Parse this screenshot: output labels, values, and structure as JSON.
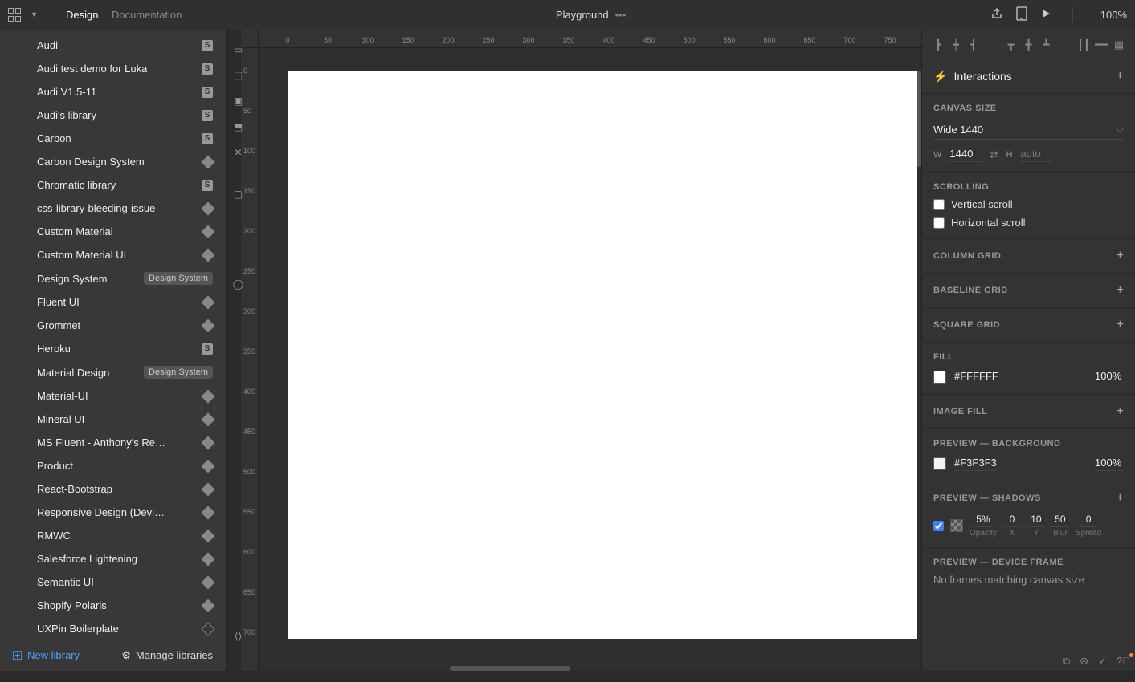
{
  "header": {
    "tabs": {
      "design": "Design",
      "documentation": "Documentation"
    },
    "title": "Playground",
    "zoom": "100%"
  },
  "libraries": {
    "items": [
      {
        "name": "Audi",
        "icon": "s"
      },
      {
        "name": "Audi test demo for Luka",
        "icon": "s"
      },
      {
        "name": "Audi V1.5-11",
        "icon": "s"
      },
      {
        "name": "Audi's library",
        "icon": "s"
      },
      {
        "name": "Carbon",
        "icon": "s"
      },
      {
        "name": "Carbon Design System",
        "icon": "d"
      },
      {
        "name": "Chromatic library",
        "icon": "s"
      },
      {
        "name": "css-library-bleeding-issue",
        "icon": "d"
      },
      {
        "name": "Custom Material",
        "icon": "d"
      },
      {
        "name": "Custom Material UI",
        "icon": "d"
      },
      {
        "name": "Design System",
        "badge": "Design System"
      },
      {
        "name": "Fluent UI",
        "icon": "d"
      },
      {
        "name": "Grommet",
        "icon": "d"
      },
      {
        "name": "Heroku",
        "icon": "s"
      },
      {
        "name": "Material Design",
        "badge": "Design System"
      },
      {
        "name": "Material-UI",
        "icon": "d"
      },
      {
        "name": "Mineral UI",
        "icon": "d"
      },
      {
        "name": "MS Fluent - Anthony's Repo",
        "icon": "d"
      },
      {
        "name": "Product",
        "icon": "d"
      },
      {
        "name": "React-Bootstrap",
        "icon": "d"
      },
      {
        "name": "Responsive Design (DeviceVie...",
        "icon": "d"
      },
      {
        "name": "RMWC",
        "icon": "d"
      },
      {
        "name": "Salesforce Lightening",
        "icon": "d"
      },
      {
        "name": "Semantic UI",
        "icon": "d"
      },
      {
        "name": "Shopify Polaris",
        "icon": "d"
      },
      {
        "name": "UXPin Boilerplate",
        "icon": "du"
      }
    ],
    "new_library": "New library",
    "manage": "Manage libraries"
  },
  "ruler_h": [
    "0",
    "50",
    "100",
    "150",
    "200",
    "250",
    "300",
    "350",
    "400",
    "450",
    "500",
    "550",
    "600",
    "650",
    "700",
    "750"
  ],
  "ruler_v": [
    "0",
    "50",
    "100",
    "150",
    "200",
    "250",
    "300",
    "350",
    "400",
    "450",
    "500",
    "550",
    "600",
    "650",
    "700"
  ],
  "right": {
    "interactions": "Interactions",
    "canvas_size": {
      "label": "CANVAS SIZE",
      "preset": "Wide 1440",
      "w_label": "W",
      "w_value": "1440",
      "h_label": "H",
      "h_placeholder": "auto"
    },
    "scrolling": {
      "label": "SCROLLING",
      "vertical": "Vertical scroll",
      "horizontal": "Horizontal scroll"
    },
    "column_grid": "COLUMN GRID",
    "baseline_grid": "BASELINE GRID",
    "square_grid": "SQUARE GRID",
    "fill": {
      "label": "FILL",
      "hex": "#FFFFFF",
      "opacity": "100%"
    },
    "image_fill": "IMAGE FILL",
    "preview_bg": {
      "label": "PREVIEW — BACKGROUND",
      "hex": "#F3F3F3",
      "opacity": "100%"
    },
    "preview_shadows": {
      "label": "PREVIEW — SHADOWS",
      "opacity": {
        "v": "5%",
        "l": "Opacity"
      },
      "x": {
        "v": "0",
        "l": "X"
      },
      "y": {
        "v": "10",
        "l": "Y"
      },
      "blur": {
        "v": "50",
        "l": "Blur"
      },
      "spread": {
        "v": "0",
        "l": "Spread"
      }
    },
    "device_frame": {
      "label": "PREVIEW — DEVICE FRAME",
      "msg": "No frames matching canvas size"
    }
  }
}
